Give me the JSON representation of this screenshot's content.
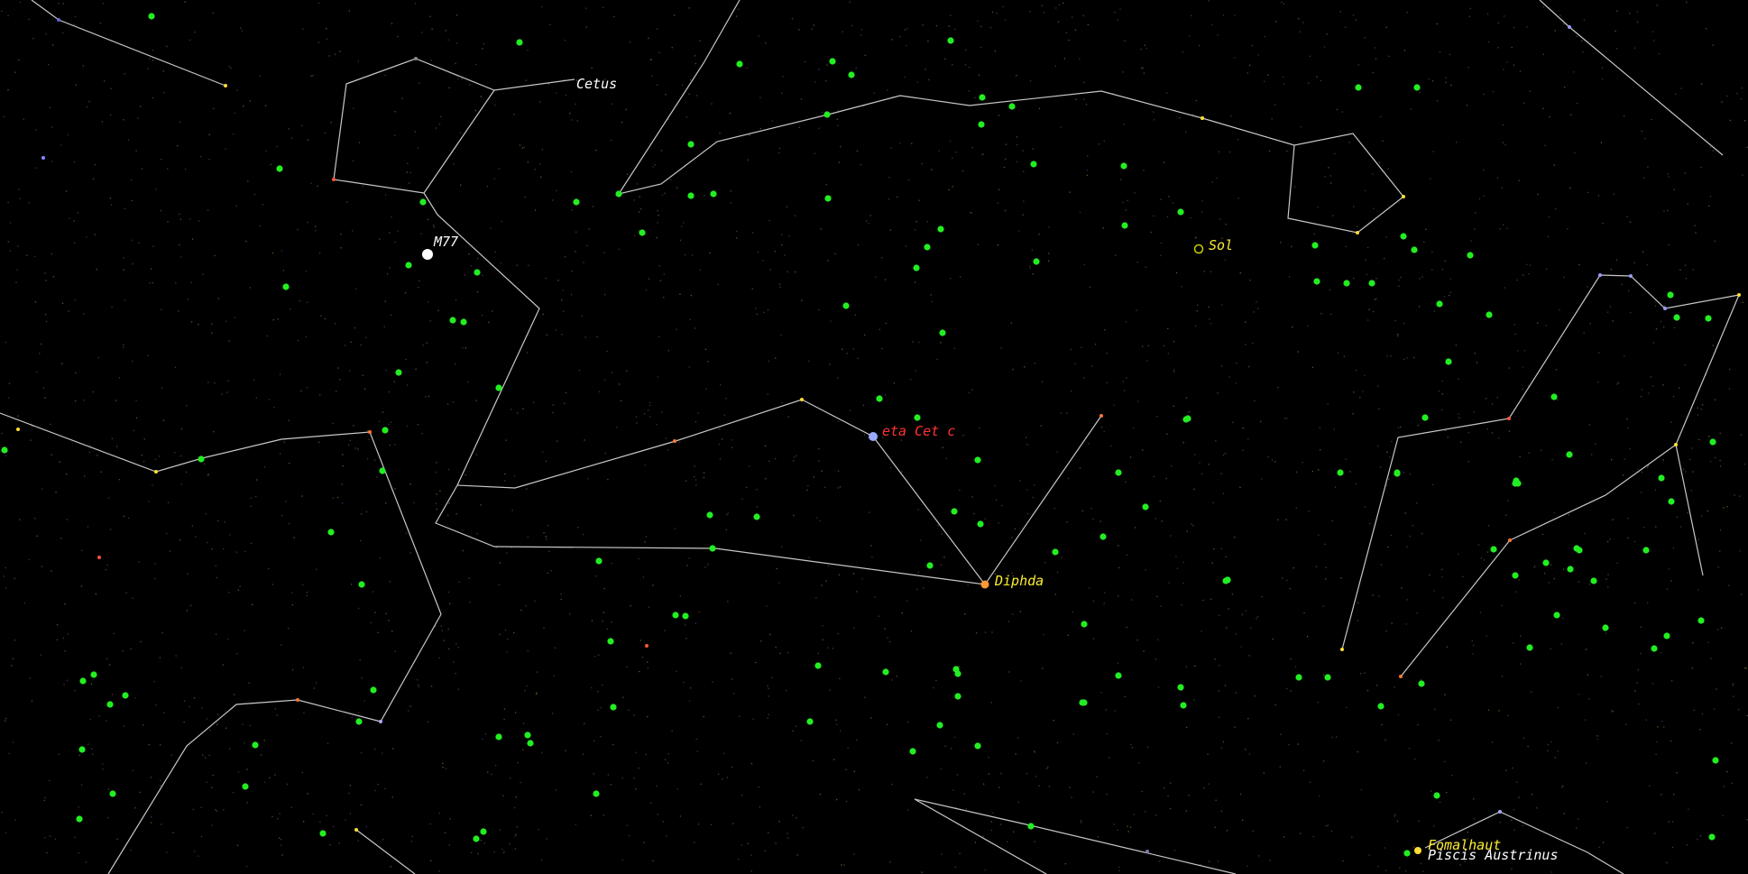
{
  "app": "Sky chart view",
  "colors": {
    "background": "#000000",
    "constellation_line": "#c8c8c8",
    "green_marker": "#22ee22",
    "named_star_label": "#ffee33",
    "exoplanet_label": "#ff3333",
    "object_label": "#ffffff"
  },
  "labels": {
    "cetus": "Cetus",
    "m77": "M77",
    "sol": "Sol",
    "eta_cet_c": "eta Cet c",
    "diphda": "Diphda",
    "fomalhaut": "Fomalhaut",
    "piscis_austrinus": "Piscis Austrinus"
  },
  "icons": [
    "star-marker",
    "galaxy-marker",
    "planet-marker"
  ]
}
